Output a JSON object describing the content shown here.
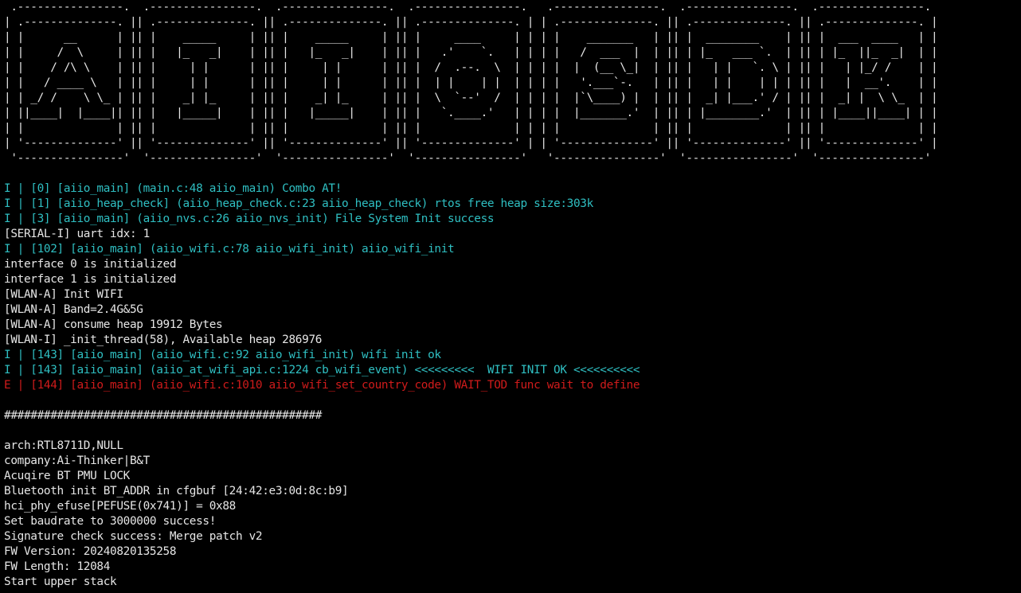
{
  "colors": {
    "background": "#000000",
    "default_text": "#e6e6e6",
    "info_text": "#2fbfc2",
    "error_text": "#d01b1b"
  },
  "lines": [
    {
      "kind": "plain",
      "text": " .----------------.  .----------------.  .----------------.  .----------------.   .----------------.  .----------------.  .----------------."
    },
    {
      "kind": "plain",
      "text": "| .--------------. || .--------------. || .--------------. || .--------------. | | .--------------. || .--------------. || .--------------. |"
    },
    {
      "kind": "plain",
      "text": "| |      __      | || |    _____     | || |    _____     | || |     ____     | | | |    _______   | || |  ________    | || |  ___  ____   | |"
    },
    {
      "kind": "plain",
      "text": "| |     /  \\     | || |   |_   _|    | || |   |_   _|    | || |   .'    `.   | | | |   /  ___  |  | || | |_   ___ `.  | || | |_  ||_  _|  | |"
    },
    {
      "kind": "plain",
      "text": "| |    / /\\ \\    | || |     | |      | || |     | |      | || |  /  .--.  \\  | | | |  |  (__ \\_|  | || |   | |   `. \\ | || |   | |_/ /    | |"
    },
    {
      "kind": "plain",
      "text": "| |   / ____ \\   | || |     | |      | || |     | |      | || |  | |    | |  | | | |   '.___`-.   | || |   | |    | | | || |   |  __'.    | |"
    },
    {
      "kind": "plain",
      "text": "| | _/ /    \\ \\_ | || |    _| |_     | || |    _| |_     | || |  \\  `--'  /  | | | |  |`\\____) |  | || |  _| |___.' / | || |  _| |  \\ \\_  | |"
    },
    {
      "kind": "plain",
      "text": "| ||____|  |____|| || |   |_____|    | || |   |_____|    | || |   `.____.'   | | | |  |_______.'  | || | |________.'  | || | |____||____| | |"
    },
    {
      "kind": "plain",
      "text": "| |              | || |              | || |              | || |              | | | |              | || |              | || |              | |"
    },
    {
      "kind": "plain",
      "text": "| '--------------' || '--------------' || '--------------' || '--------------' | | '--------------' || '--------------' || '--------------' |"
    },
    {
      "kind": "plain",
      "text": " '----------------'  '----------------'  '----------------'  '----------------'   '----------------'  '----------------'  '----------------'"
    },
    {
      "kind": "plain",
      "text": ""
    },
    {
      "kind": "info",
      "text": "I | [0] [aiio_main] (main.c:48 aiio_main) Combo AT!"
    },
    {
      "kind": "info",
      "text": "I | [1] [aiio_heap_check] (aiio_heap_check.c:23 aiio_heap_check) rtos free heap size:303k"
    },
    {
      "kind": "info",
      "text": "I | [3] [aiio_main] (aiio_nvs.c:26 aiio_nvs_init) File System Init success"
    },
    {
      "kind": "plain",
      "text": "[SERIAL-I] uart idx: 1"
    },
    {
      "kind": "info",
      "text": "I | [102] [aiio_main] (aiio_wifi.c:78 aiio_wifi_init) aiio_wifi_init"
    },
    {
      "kind": "plain",
      "text": "interface 0 is initialized"
    },
    {
      "kind": "plain",
      "text": "interface 1 is initialized"
    },
    {
      "kind": "plain",
      "text": "[WLAN-A] Init WIFI"
    },
    {
      "kind": "plain",
      "text": "[WLAN-A] Band=2.4G&5G"
    },
    {
      "kind": "plain",
      "text": "[WLAN-A] consume heap 19912 Bytes"
    },
    {
      "kind": "plain",
      "text": "[WLAN-I] _init_thread(58), Available heap 286976"
    },
    {
      "kind": "info",
      "text": "I | [143] [aiio_main] (aiio_wifi.c:92 aiio_wifi_init) wifi init ok"
    },
    {
      "kind": "info",
      "text": "I | [143] [aiio_main] (aiio_at_wifi_api.c:1224 cb_wifi_event) <<<<<<<<<  WIFI INIT OK <<<<<<<<<<"
    },
    {
      "kind": "error",
      "text": "E | [144] [aiio_main] (aiio_wifi.c:1010 aiio_wifi_set_country_code) WAIT_TOD func wait to define"
    },
    {
      "kind": "plain",
      "text": ""
    },
    {
      "kind": "plain",
      "text": "################################################"
    },
    {
      "kind": "plain",
      "text": ""
    },
    {
      "kind": "plain",
      "text": "arch:RTL8711D,NULL"
    },
    {
      "kind": "plain",
      "text": "company:Ai-Thinker|B&T"
    },
    {
      "kind": "plain",
      "text": "Acuqire BT PMU LOCK"
    },
    {
      "kind": "plain",
      "text": "Bluetooth init BT_ADDR in cfgbuf [24:42:e3:0d:8c:b9]"
    },
    {
      "kind": "plain",
      "text": "hci_phy_efuse[PEFUSE(0x741)] = 0x88"
    },
    {
      "kind": "plain",
      "text": "Set baudrate to 3000000 success!"
    },
    {
      "kind": "plain",
      "text": "Signature check success: Merge patch v2"
    },
    {
      "kind": "plain",
      "text": "FW Version: 20240820135258"
    },
    {
      "kind": "plain",
      "text": "FW Length: 12084"
    },
    {
      "kind": "plain",
      "text": "Start upper stack"
    }
  ]
}
